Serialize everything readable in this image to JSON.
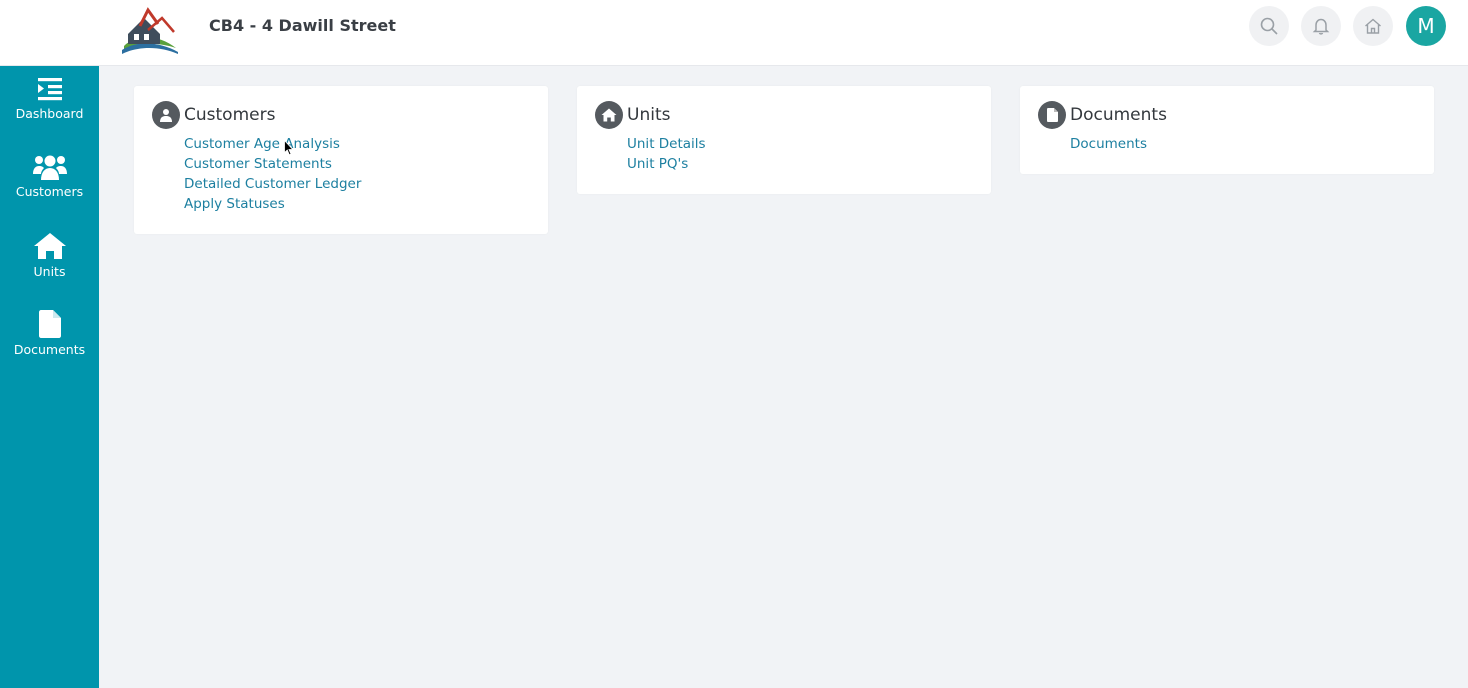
{
  "header": {
    "title": "CB4 - 4 Dawill Street",
    "avatar_initial": "M",
    "icons": [
      "search-icon",
      "bell-icon",
      "home-icon"
    ]
  },
  "sidebar": {
    "items": [
      {
        "label": "Dashboard",
        "icon": "dashboard-list-icon"
      },
      {
        "label": "Customers",
        "icon": "users-icon"
      },
      {
        "label": "Units",
        "icon": "home-icon"
      },
      {
        "label": "Documents",
        "icon": "document-icon"
      }
    ]
  },
  "cards": [
    {
      "title": "Customers",
      "icon": "user-icon",
      "links": [
        "Customer Age Analysis",
        "Customer Statements",
        "Detailed Customer Ledger",
        "Apply Statuses"
      ]
    },
    {
      "title": "Units",
      "icon": "home-icon",
      "links": [
        "Unit Details",
        "Unit PQ's"
      ]
    },
    {
      "title": "Documents",
      "icon": "document-icon",
      "links": [
        "Documents"
      ]
    }
  ],
  "colors": {
    "sidebar": "#0095ac",
    "link": "#1c7fa0",
    "avatar": "#1aa6a2",
    "background": "#f1f3f6"
  }
}
